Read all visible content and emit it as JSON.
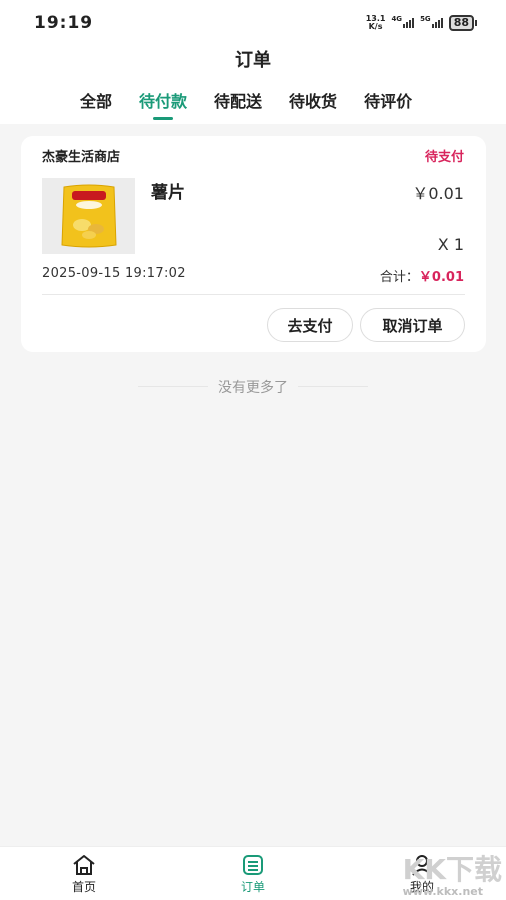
{
  "status_bar": {
    "time": "19:19",
    "speed_value": "13.1",
    "speed_unit": "K/s",
    "net1": "4G",
    "net2": "5G",
    "battery": "88"
  },
  "header": {
    "title": "订单",
    "tabs": [
      {
        "label": "全部",
        "active": false
      },
      {
        "label": "待付款",
        "active": true
      },
      {
        "label": "待配送",
        "active": false
      },
      {
        "label": "待收货",
        "active": false
      },
      {
        "label": "待评价",
        "active": false
      }
    ]
  },
  "order": {
    "shop_name": "杰豪生活商店",
    "status": "待支付",
    "product": {
      "name": "薯片",
      "price": "￥0.01",
      "quantity": "X 1"
    },
    "created_at": "2025-09-15 19:17:02",
    "total_label": "合计：",
    "total_amount": "￥0.01",
    "actions": {
      "pay": "去支付",
      "cancel": "取消订单"
    }
  },
  "list_footer": "没有更多了",
  "bottom_nav": {
    "items": [
      {
        "label": "首页",
        "icon": "home-icon"
      },
      {
        "label": "订单",
        "icon": "order-icon",
        "active": true
      },
      {
        "label": "我的",
        "icon": "user-icon"
      }
    ]
  },
  "watermark": {
    "text": "KK下载",
    "domain": "www.kkx.net"
  },
  "colors": {
    "accent": "#1a9a78",
    "status_pink": "#d8245c",
    "background": "#f5f5f5"
  }
}
